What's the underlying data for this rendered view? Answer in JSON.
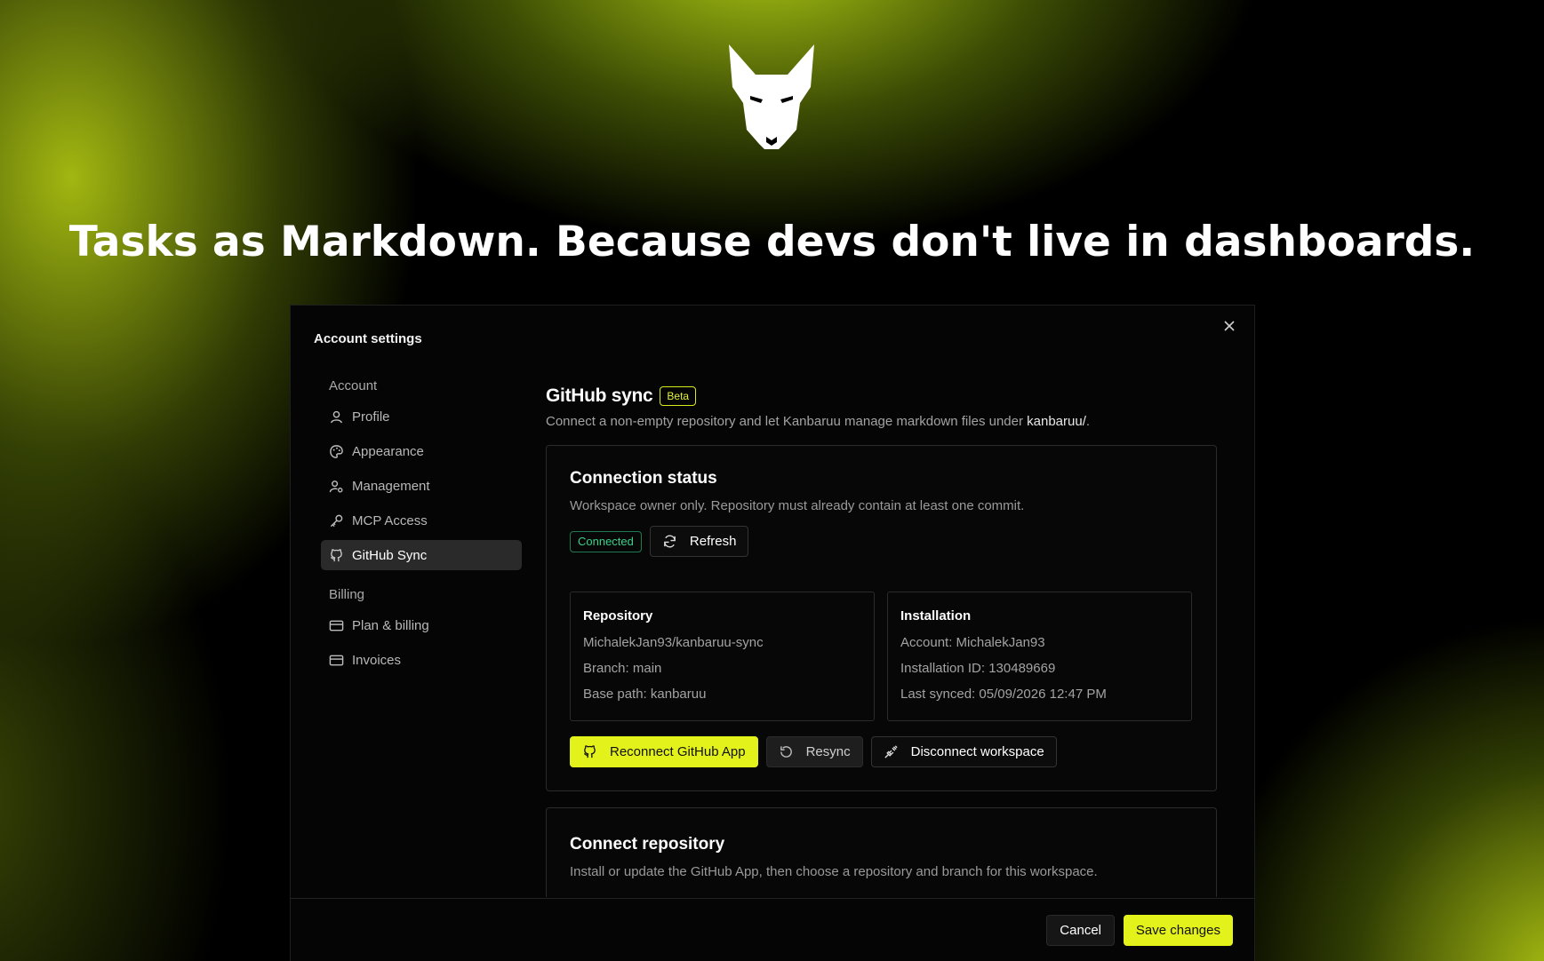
{
  "hero": {
    "headline": "Tasks as Markdown. Because devs don't live in dashboards."
  },
  "modal": {
    "title": "Account settings",
    "close_icon": "close-icon"
  },
  "sidebar": {
    "groups": [
      {
        "label": "Account",
        "items": [
          {
            "label": "Profile",
            "icon": "user-icon"
          },
          {
            "label": "Appearance",
            "icon": "palette-icon"
          },
          {
            "label": "Management",
            "icon": "user-cog-icon"
          },
          {
            "label": "MCP Access",
            "icon": "key-icon"
          },
          {
            "label": "GitHub Sync",
            "icon": "github-icon",
            "active": true
          }
        ]
      },
      {
        "label": "Billing",
        "items": [
          {
            "label": "Plan & billing",
            "icon": "credit-card-icon"
          },
          {
            "label": "Invoices",
            "icon": "credit-card-icon"
          }
        ]
      }
    ]
  },
  "section": {
    "title": "GitHub sync",
    "badge": "Beta",
    "desc_prefix": "Connect a non-empty repository and let Kanbaruu manage markdown files under ",
    "desc_path": "kanbaruu/",
    "desc_suffix": "."
  },
  "connection": {
    "title": "Connection status",
    "desc": "Workspace owner only. Repository must already contain at least one commit.",
    "status": "Connected",
    "refresh_label": "Refresh",
    "repository": {
      "title": "Repository",
      "name": "MichalekJan93/kanbaruu-sync",
      "branch": "Branch: main",
      "base_path": "Base path: kanbaruu"
    },
    "installation": {
      "title": "Installation",
      "account": "Account: MichalekJan93",
      "installation_id": "Installation ID: 130489669",
      "last_synced": "Last synced: 05/09/2026 12:47 PM"
    },
    "actions": {
      "reconnect": "Reconnect GitHub App",
      "resync": "Resync",
      "disconnect": "Disconnect workspace"
    }
  },
  "connect_repo": {
    "title": "Connect repository",
    "desc": "Install or update the GitHub App, then choose a repository and branch for this workspace."
  },
  "footer": {
    "cancel": "Cancel",
    "save": "Save changes"
  },
  "colors": {
    "accent": "#e4f21b",
    "connected": "#3ad18a",
    "background": "#000000"
  }
}
